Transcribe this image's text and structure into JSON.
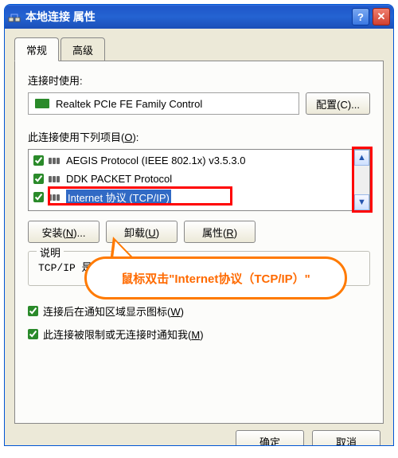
{
  "window": {
    "title": "本地连接 属性"
  },
  "tabs": {
    "general": "常规",
    "advanced": "高级"
  },
  "labels": {
    "connect_using": "连接时使用:",
    "items_used": "此连接使用下列项目(O):",
    "description_legend": "说明",
    "config_btn": "配置(C)...",
    "install_btn": "安装(N)...",
    "uninstall_btn": "卸载(U)",
    "properties_btn": "属性(R)",
    "ok": "确定",
    "cancel": "取消"
  },
  "adapter": {
    "name": "Realtek PCIe FE Family Control"
  },
  "items": [
    {
      "label": "AEGIS Protocol (IEEE 802.1x) v3.5.3.0",
      "checked": true,
      "selected": false
    },
    {
      "label": "DDK PACKET Protocol",
      "checked": true,
      "selected": false
    },
    {
      "label": "Internet 协议 (TCP/IP)",
      "checked": true,
      "selected": true
    }
  ],
  "description": {
    "text": "TCP/IP 是默认的广域网协议。它提供跨越多种互联网络的通讯。"
  },
  "checkboxes": {
    "show_icon": "连接后在通知区域显示图标(W)",
    "notify_limited": "此连接被限制或无连接时通知我(M)"
  },
  "callout": {
    "text": "鼠标双击\"Internet协议（TCP/IP）\""
  },
  "underline": {
    "O": "O",
    "C": "C",
    "N": "N",
    "U": "U",
    "R": "R",
    "W": "W",
    "M": "M"
  }
}
